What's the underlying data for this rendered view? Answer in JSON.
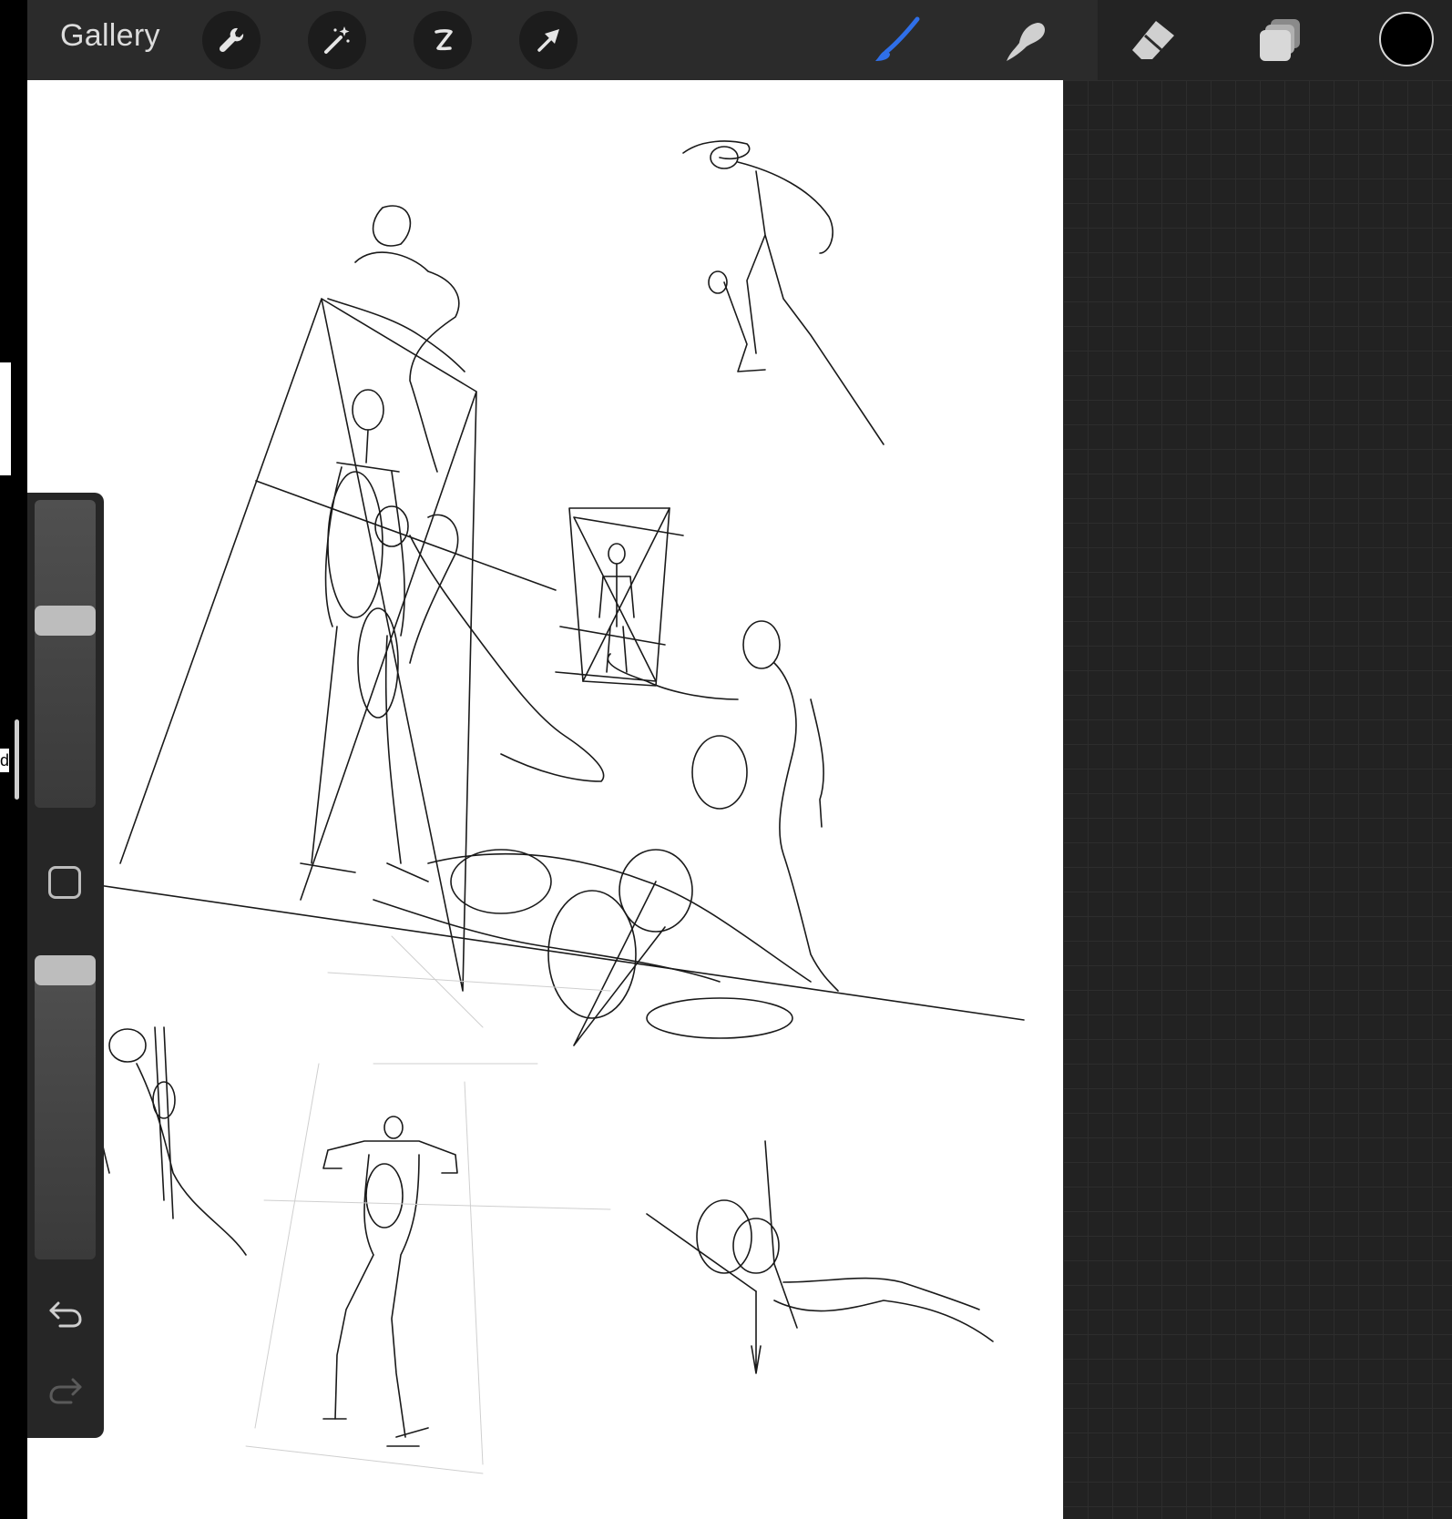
{
  "toolbar": {
    "gallery_label": "Gallery",
    "tools": [
      "wrench-icon",
      "magic-wand-icon",
      "selection-icon",
      "transform-arrow-icon"
    ],
    "right_tools": [
      "brush-icon",
      "smudge-icon",
      "eraser-icon",
      "layers-icon"
    ],
    "active_tool": "brush",
    "brush_color": "#000000",
    "accent_color": "#2f6fe8"
  },
  "sidebar": {
    "brush_size": 0.62,
    "brush_opacity": 1.0,
    "icons": [
      "modify-square-icon",
      "undo-icon",
      "redo-icon"
    ],
    "redo_enabled": false
  },
  "edge": {
    "letter": "d"
  }
}
